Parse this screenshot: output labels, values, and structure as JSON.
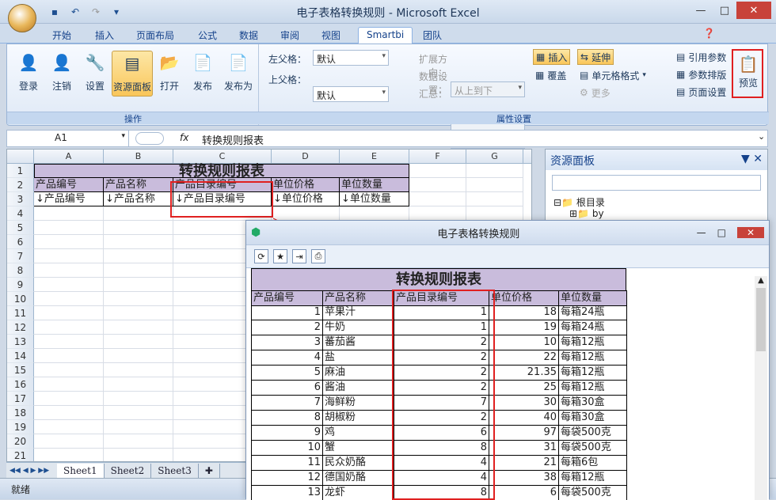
{
  "window": {
    "title": "电子表格转换规则 - Microsoft Excel"
  },
  "tabs": [
    "开始",
    "插入",
    "页面布局",
    "公式",
    "数据",
    "审阅",
    "视图",
    "Smartbi",
    "团队"
  ],
  "active_tab": "Smartbi",
  "ops_group": {
    "label": "操作",
    "buttons": [
      "登录",
      "注销",
      "设置",
      "资源面板",
      "打开",
      "发布",
      "发布为"
    ]
  },
  "attr_group": {
    "label": "属性设置",
    "left_parent_label": "左父格：",
    "left_parent_value": "默认",
    "top_parent_label": "上父格：",
    "top_parent_value": "默认",
    "expand_label": "扩展方向：",
    "expand_value": "从上到下",
    "data_setting_label": "数据设置：",
    "summary_label": "汇总："
  },
  "right_buttons": {
    "insert": "插入",
    "extend": "延伸",
    "overwrite": "覆盖",
    "cell_format": "单元格格式",
    "more": "更多",
    "ref_param": "引用参数",
    "param_layout": "参数排版",
    "page_setup": "页面设置",
    "preview": "预览"
  },
  "formula_bar": {
    "namebox": "A1",
    "fx": "fx",
    "value": "转换规则报表"
  },
  "sheet": {
    "columns": [
      "A",
      "B",
      "C",
      "D",
      "E",
      "F",
      "G"
    ],
    "title": "转换规则报表",
    "headers": [
      "产品编号",
      "产品名称",
      "产品目录编号",
      "单位价格",
      "单位数量"
    ],
    "fields": [
      "↓产品编号",
      "↓产品名称",
      "↓产品目录编号",
      "↓单位价格",
      "↓单位数量"
    ],
    "row_numbers": [
      "1",
      "2",
      "3",
      "4",
      "5",
      "6",
      "7",
      "8",
      "9",
      "10",
      "11",
      "12",
      "13",
      "14",
      "15",
      "16",
      "17",
      "18",
      "19",
      "20",
      "21"
    ],
    "tabs": [
      "Sheet1",
      "Sheet2",
      "Sheet3"
    ]
  },
  "status": {
    "ready": "就绪"
  },
  "resource_panel": {
    "title": "资源面板",
    "root": "根目录",
    "child": "by"
  },
  "preview": {
    "title": "电子表格转换规则",
    "sheet_title": "转换规则报表",
    "headers": [
      "产品编号",
      "产品名称",
      "产品目录编号",
      "单位价格",
      "单位数量"
    ],
    "rows": [
      [
        "1",
        "苹果汁",
        "1",
        "18",
        "每箱24瓶"
      ],
      [
        "2",
        "牛奶",
        "1",
        "19",
        "每箱24瓶"
      ],
      [
        "3",
        "蕃茄酱",
        "2",
        "10",
        "每箱12瓶"
      ],
      [
        "4",
        "盐",
        "2",
        "22",
        "每箱12瓶"
      ],
      [
        "5",
        "麻油",
        "2",
        "21.35",
        "每箱12瓶"
      ],
      [
        "6",
        "酱油",
        "2",
        "25",
        "每箱12瓶"
      ],
      [
        "7",
        "海鲜粉",
        "7",
        "30",
        "每箱30盒"
      ],
      [
        "8",
        "胡椒粉",
        "2",
        "40",
        "每箱30盒"
      ],
      [
        "9",
        "鸡",
        "6",
        "97",
        "每袋500克"
      ],
      [
        "10",
        "蟹",
        "8",
        "31",
        "每袋500克"
      ],
      [
        "11",
        "民众奶酪",
        "4",
        "21",
        "每箱6包"
      ],
      [
        "12",
        "德国奶酪",
        "4",
        "38",
        "每箱12瓶"
      ],
      [
        "13",
        "龙虾",
        "8",
        "6",
        "每袋500克"
      ]
    ]
  }
}
